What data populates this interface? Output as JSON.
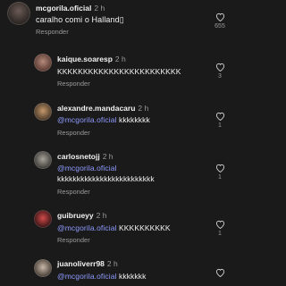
{
  "comments": [
    {
      "user": "mcgorila.oficial",
      "time": "2 h",
      "mention": "",
      "text": "caralho comi o Halland▯",
      "reply": "Responder",
      "likes": "655"
    },
    {
      "user": "kaique.soaresp",
      "time": "2 h",
      "mention": "",
      "text": "KKKKKKKKKKKKKKKKKKKKKKKK",
      "reply": "Responder",
      "likes": "3"
    },
    {
      "user": "alexandre.mandacaru",
      "time": "2 h",
      "mention": "@mcgorila.oficial",
      "text": " kkkkkkkk",
      "reply": "Responder",
      "likes": "1"
    },
    {
      "user": "carlosnetojj",
      "time": "2 h",
      "mention": "@mcgorila.oficial",
      "text": "kkkkkkkkkkkkkkkkkkkkkkkkk",
      "reply": "Responder",
      "likes": "1"
    },
    {
      "user": "guibrueyy",
      "time": "2 h",
      "mention": "@mcgorila.oficial",
      "text": " KKKKKKKKKK",
      "reply": "Responder",
      "likes": "1"
    },
    {
      "user": "juanoliverr98",
      "time": "2 h",
      "mention": "@mcgorila.oficial",
      "text": " kkkkkkk",
      "reply": "",
      "likes": ""
    }
  ],
  "colors": {
    "background": "#1a1a1a",
    "text": "#f2f2f2",
    "muted": "#9a9a9a",
    "mention": "#8f9bff"
  },
  "icons": {
    "like": "heart-outline-icon"
  }
}
